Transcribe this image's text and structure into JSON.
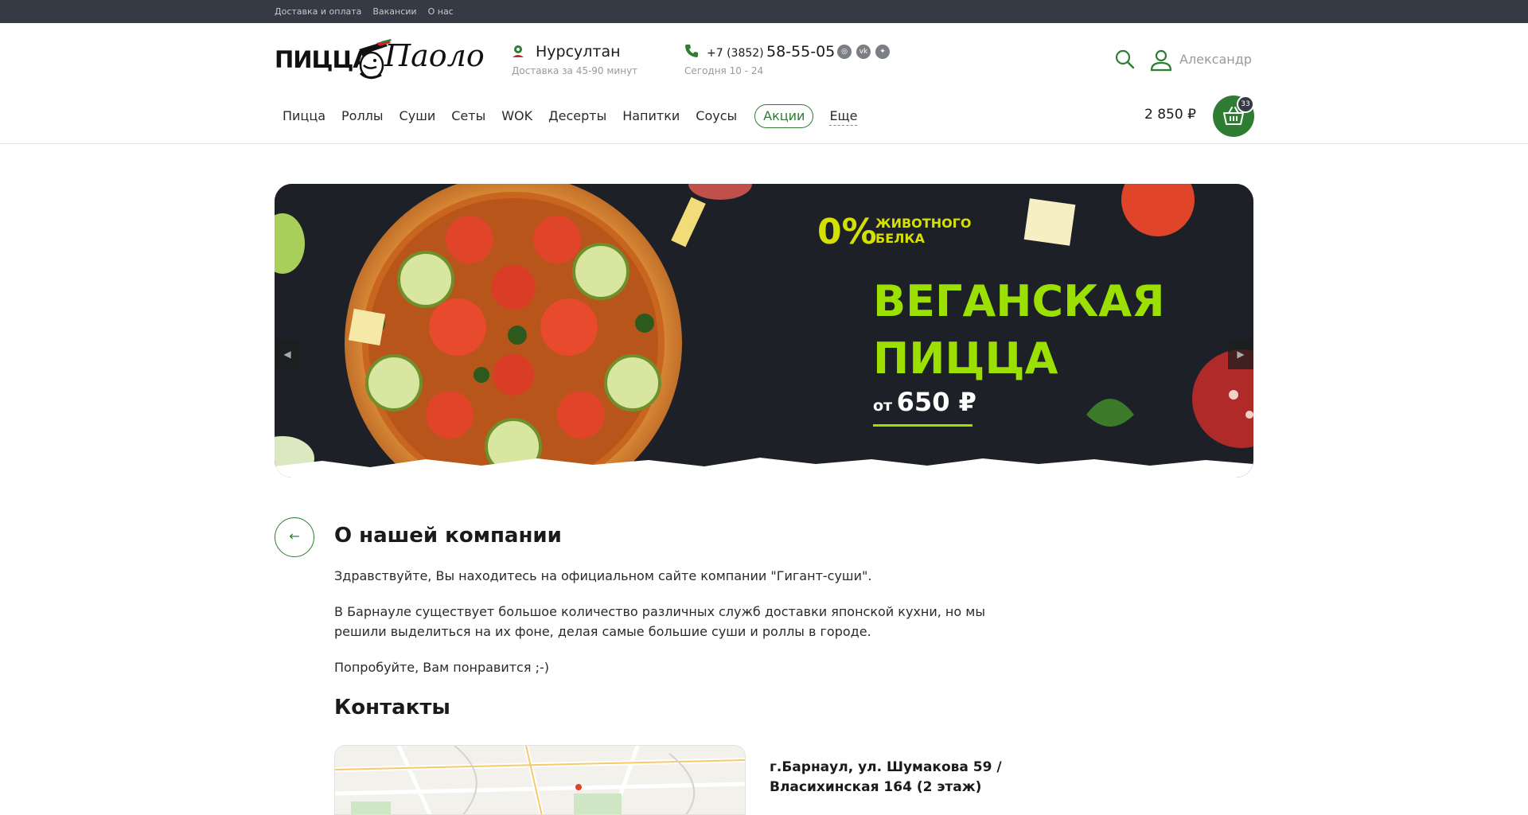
{
  "topbar": {
    "links": [
      "Доставка и оплата",
      "Вакансии",
      "О нас"
    ]
  },
  "header": {
    "logo": {
      "text": "ПИЦЦА",
      "script": "Паоло"
    },
    "city": {
      "name": "Нурсултан",
      "delivery_time": "Доставка за 45-90 минут"
    },
    "phone": {
      "prefix": "+7 (3852)",
      "number": "58-55-05",
      "hours": "Сегодня 10 - 24"
    },
    "socials": [
      "instagram-icon",
      "vk-icon",
      "other-social-icon"
    ],
    "user_name": "Александр"
  },
  "nav": {
    "items": [
      "Пицца",
      "Роллы",
      "Суши",
      "Сеты",
      "WOK",
      "Десерты",
      "Напитки",
      "Соусы"
    ],
    "promo": "Акции",
    "more": "Еще"
  },
  "cart": {
    "total": "2 850 ₽",
    "count": "33"
  },
  "banner": {
    "percent": "0%",
    "percent_sub": "ЖИВОТНОГО БЕЛКА",
    "title_line1": "ВЕГАНСКАЯ",
    "title_line2": "ПИЦЦА",
    "price_from": "от",
    "price": "650 ₽"
  },
  "content": {
    "title": "О нашей компании",
    "paragraph1": "Здравствуйте, Вы находитесь на официальном сайте компании \"Гигант-суши\".",
    "paragraph2": "В Барнауле существует большое количество различных служб доставки японской кухни, но мы решили выделиться на их фоне, делая самые большие суши и роллы в городе.",
    "paragraph3": "Попробуйте, Вам понравится ;-)",
    "contacts_title": "Контакты",
    "address": "г.Барнаул, ул. Шумакова 59 / Власихинская 164 (2 этаж)"
  },
  "colors": {
    "accent": "#2e7d32",
    "topbar": "#363a45",
    "banner_lime": "#9be000"
  }
}
